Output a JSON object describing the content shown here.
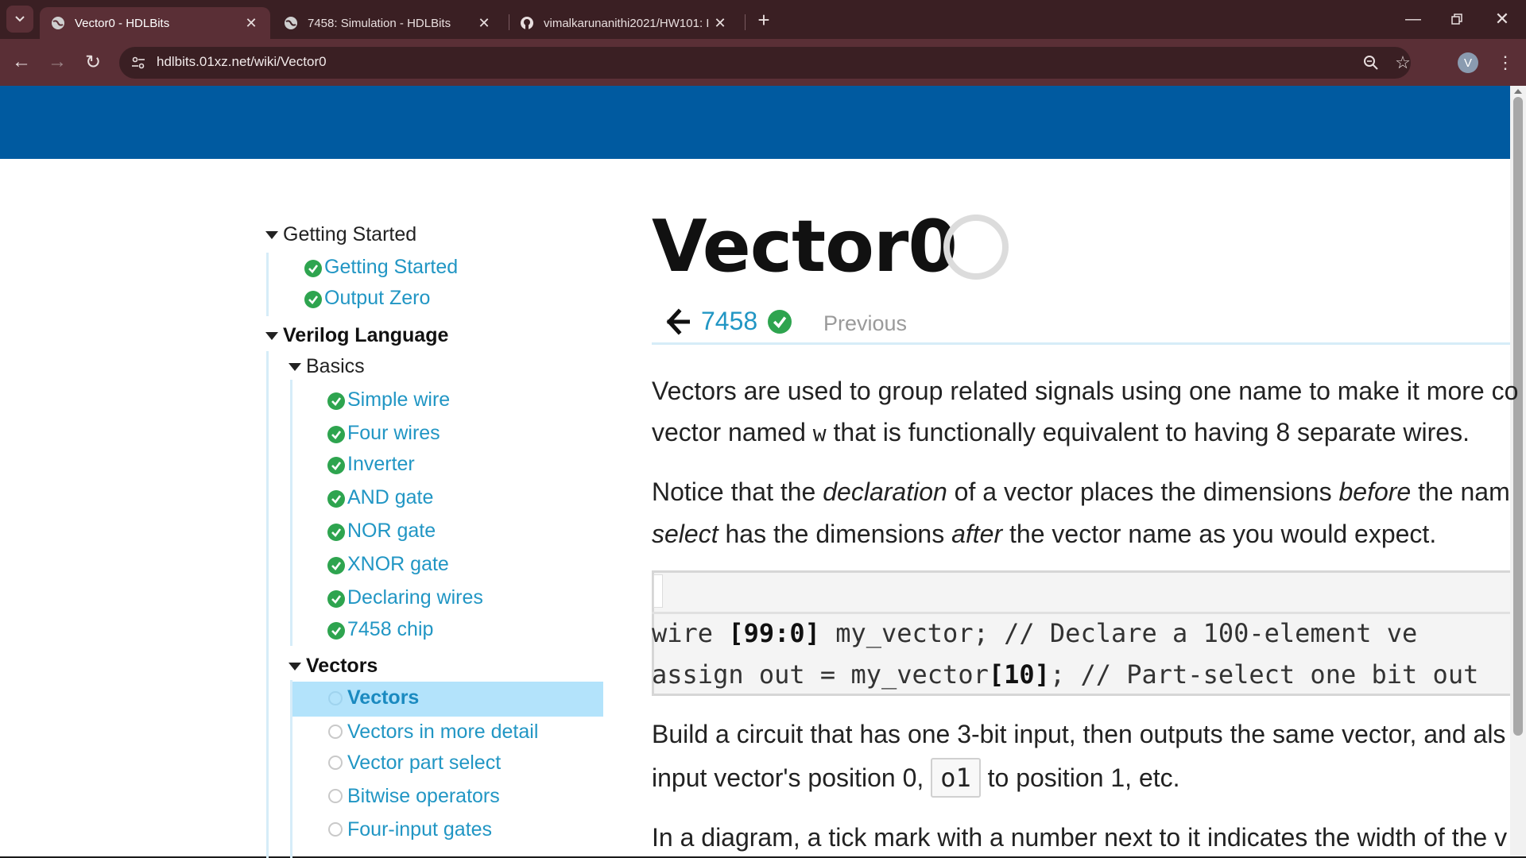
{
  "browser": {
    "tabs": [
      {
        "title": "Vector0 - HDLBits",
        "active": true,
        "icon": "globe-icon"
      },
      {
        "title": "7458: Simulation - HDLBits",
        "active": false,
        "icon": "globe-icon"
      },
      {
        "title": "vimalkarunanithi2021/HW101: I",
        "active": false,
        "icon": "github-icon"
      }
    ],
    "url": "hdlbits.01xz.net/wiki/Vector0",
    "profile_initial": "V"
  },
  "sidebar": {
    "sections": {
      "getting_started": "Getting Started",
      "getting_started_items": [
        "Getting Started",
        "Output Zero"
      ],
      "verilog_language": "Verilog Language",
      "basics": "Basics",
      "basics_items": [
        "Simple wire",
        "Four wires",
        "Inverter",
        "AND gate",
        "NOR gate",
        "XNOR gate",
        "Declaring wires",
        "7458 chip"
      ],
      "vectors": "Vectors",
      "vectors_items": [
        "Vectors",
        "Vectors in more detail",
        "Vector part select",
        "Bitwise operators",
        "Four-input gates"
      ]
    }
  },
  "main": {
    "title": "Vector0",
    "prev_link": "7458",
    "prev_label": "Previous",
    "p1_line1": "Vectors are used to group related signals using one name to make it more co",
    "p1_line2_a": "vector named ",
    "p1_line2_code": "w",
    "p1_line2_b": " that is functionally equivalent to having 8 separate wires.",
    "p2_line1_a": "Notice that the ",
    "p2_line1_em1": "declaration",
    "p2_line1_b": " of a vector places the dimensions ",
    "p2_line1_em2": "before",
    "p2_line1_c": " the nam",
    "p2_line2_em": "select",
    "p2_line2_a": " has the dimensions ",
    "p2_line2_em2": "after",
    "p2_line2_b": " the vector name as you would expect.",
    "code1_a": "wire ",
    "code1_b": "[99:0]",
    "code1_c": " my_vector;      // Declare a 100-element ve",
    "code2_a": "assign out = my_vector",
    "code2_b": "[10]",
    "code2_c": "; // Part-select one bit out",
    "p3_line1": "Build a circuit that has one 3-bit input, then outputs the same vector, and als",
    "p3_line2_a": "input vector's position 0, ",
    "p3_line2_code": "o1",
    "p3_line2_b": " to position 1, etc.",
    "p4_line1": "In a diagram, a tick mark with a number next to it indicates the width of the v"
  },
  "colors": {
    "header_blue": "#005aa0",
    "link": "#2196c4",
    "check_green": "#2ea44f",
    "highlight": "#b3e3fb"
  }
}
